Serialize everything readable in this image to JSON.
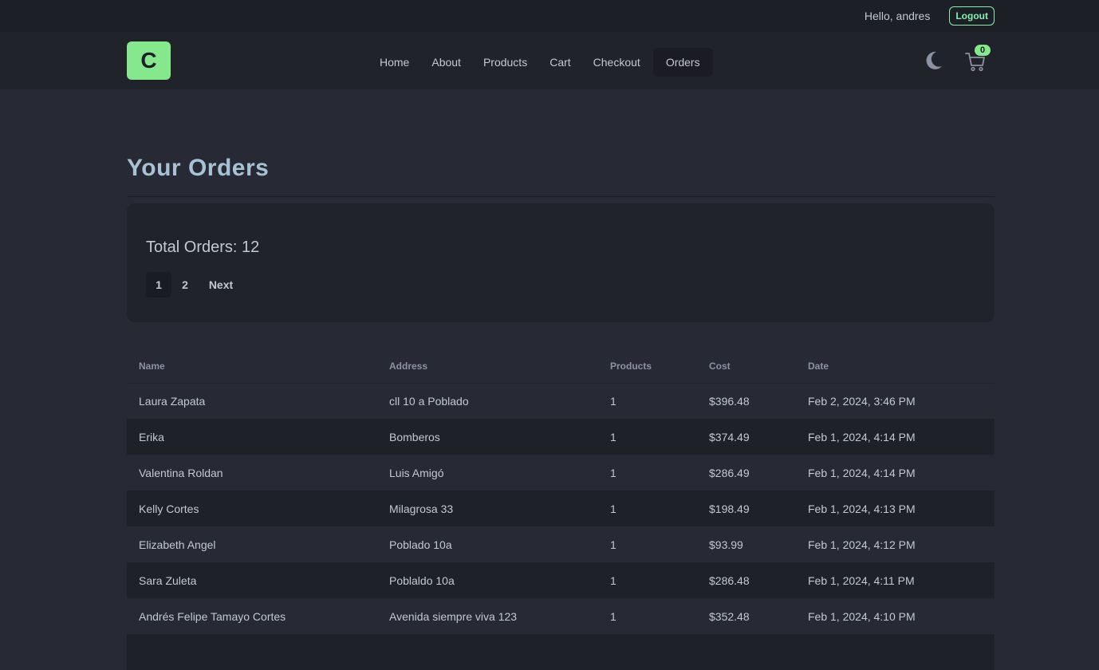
{
  "topbar": {
    "greeting": "Hello, andres",
    "logout_label": "Logout"
  },
  "navbar": {
    "logo_letter": "C",
    "links": [
      "Home",
      "About",
      "Products",
      "Cart",
      "Checkout",
      "Orders"
    ],
    "active_link": "Orders",
    "cart_count": "0",
    "icons": {
      "theme": "moon-icon",
      "cart": "cart-icon"
    },
    "accent_color": "#86e88c"
  },
  "main": {
    "title": "Your Orders",
    "total_orders": "Total Orders: 12",
    "pagination": {
      "pages": [
        "1",
        "2"
      ],
      "current": "1",
      "next_label": "Next"
    },
    "table": {
      "headers": [
        "Name",
        "Address",
        "Products",
        "Cost",
        "Date"
      ],
      "rows": [
        [
          "Laura Zapata",
          "cll 10 a Poblado",
          "1",
          "$396.48",
          "Feb 2, 2024, 3:46 PM"
        ],
        [
          "Erika",
          "Bomberos",
          "1",
          "$374.49",
          "Feb 1, 2024, 4:14 PM"
        ],
        [
          "Valentina Roldan",
          "Luis Amigó",
          "1",
          "$286.49",
          "Feb 1, 2024, 4:14 PM"
        ],
        [
          "Kelly Cortes",
          "Milagrosa 33",
          "1",
          "$198.49",
          "Feb 1, 2024, 4:13 PM"
        ],
        [
          "Elizabeth Angel",
          "Poblado 10a",
          "1",
          "$93.99",
          "Feb 1, 2024, 4:12 PM"
        ],
        [
          "Sara Zuleta",
          "Poblaldo 10a",
          "1",
          "$286.48",
          "Feb 1, 2024, 4:11 PM"
        ],
        [
          "Andrés Felipe Tamayo Cortes",
          "Avenida siempre viva 123",
          "1",
          "$352.48",
          "Feb 1, 2024, 4:10 PM"
        ]
      ]
    }
  }
}
